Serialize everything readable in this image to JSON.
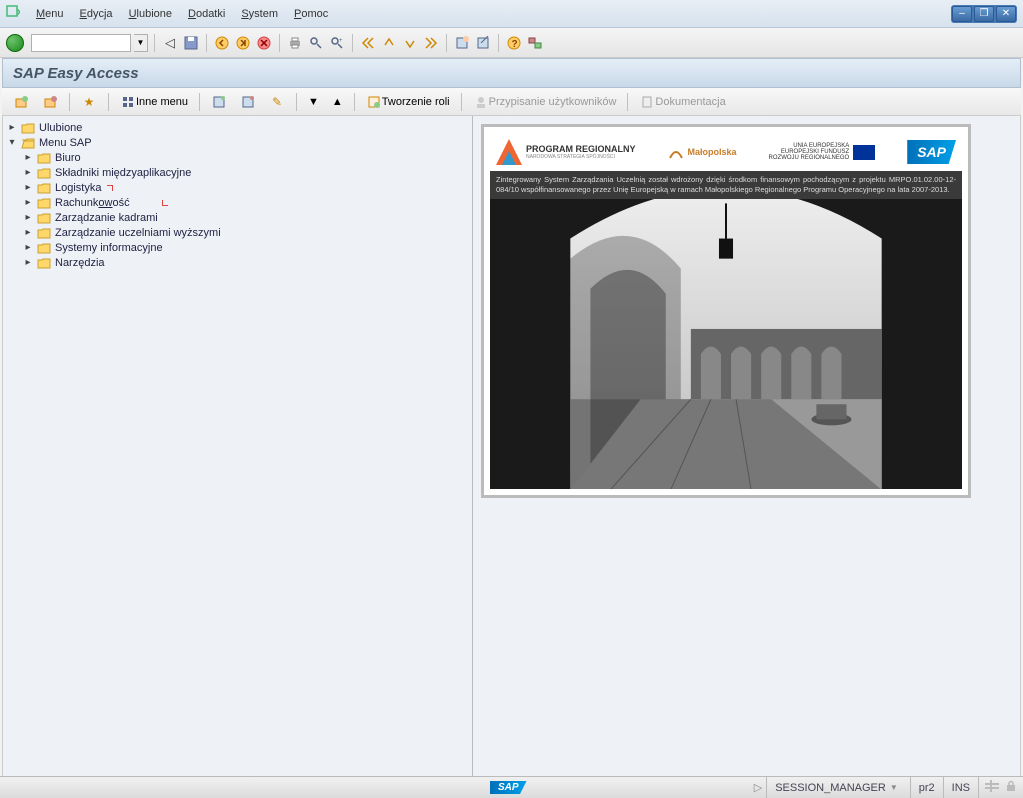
{
  "menubar": [
    {
      "label": "Menu",
      "ul": "M",
      "rest": "enu"
    },
    {
      "label": "Edycja",
      "ul": "E",
      "rest": "dycja"
    },
    {
      "label": "Ulubione",
      "ul": "U",
      "rest": "lubione"
    },
    {
      "label": "Dodatki",
      "ul": "D",
      "rest": "odatki"
    },
    {
      "label": "System",
      "ul": "S",
      "rest": "ystem"
    },
    {
      "label": "Pomoc",
      "ul": "P",
      "rest": "omoc"
    }
  ],
  "title": "SAP Easy Access",
  "command_input": "",
  "app_toolbar": {
    "inne_menu": "Inne menu",
    "tworzenie_roli": "Tworzenie roli",
    "przypisanie": "Przypisanie użytkowników",
    "dokumentacja": "Dokumentacja"
  },
  "tree": {
    "root1": "Ulubione",
    "root2": "Menu SAP",
    "children": [
      "Biuro",
      "Składniki międzyaplikacyjne",
      "Logistyka",
      "Rachunkowość",
      "Zarządzanie kadrami",
      "Zarządzanie uczelniami wyższymi",
      "Systemy informacyjne",
      "Narzędzia"
    ]
  },
  "logos": {
    "program_regionalny": "PROGRAM REGIONALNY",
    "program_sub": "NARODOWA STRATEGIA SPÓJNOŚCI",
    "malopolska": "Małopolska",
    "eu_text": "UNIA EUROPEJSKA\nEUROPEJSKI FUNDUSZ\nROZWOJU REGIONALNEGO",
    "sap": "SAP"
  },
  "info_text": "Zintegrowany System Zarządzania Uczelnią został wdrożony dzięki środkom finansowym pochodzącym z projektu MRPO.01.02.00-12-084/10 współfinansowanego przez Unię Europejską w ramach Małopolskiego Regionalnego Programu Operacyjnego na lata 2007-2013.",
  "status": {
    "session": "SESSION_MANAGER",
    "server": "pr2",
    "mode": "INS",
    "sap_label": "SAP"
  }
}
